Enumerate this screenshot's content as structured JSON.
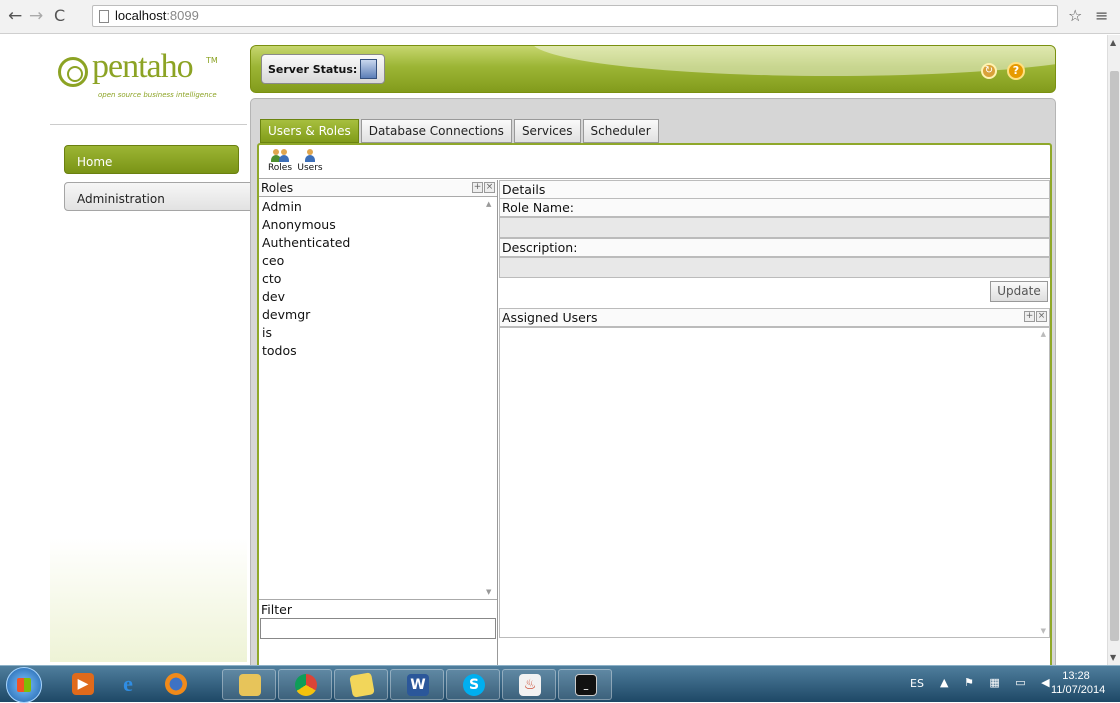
{
  "browser": {
    "url_host": "localhost",
    "url_port": ":8099"
  },
  "brand": {
    "name": "pentaho",
    "tm": "TM",
    "tagline": "open source business intelligence"
  },
  "nav": {
    "home": "Home",
    "administration": "Administration"
  },
  "header": {
    "server_status": "Server Status:",
    "accent": "#8ca324"
  },
  "tabs": [
    "Users & Roles",
    "Database Connections",
    "Services",
    "Scheduler"
  ],
  "toolbar": {
    "roles": "Roles",
    "users": "Users"
  },
  "roles": {
    "title": "Roles",
    "items": [
      "Admin",
      "Anonymous",
      "Authenticated",
      "ceo",
      "cto",
      "dev",
      "devmgr",
      "is",
      "todos"
    ],
    "filter_label": "Filter"
  },
  "details": {
    "title": "Details",
    "role_name_label": "Role Name:",
    "description_label": "Description:",
    "update": "Update",
    "assigned_users": "Assigned Users"
  },
  "tray": {
    "lang": "ES",
    "time": "13:28",
    "date": "11/07/2014"
  }
}
